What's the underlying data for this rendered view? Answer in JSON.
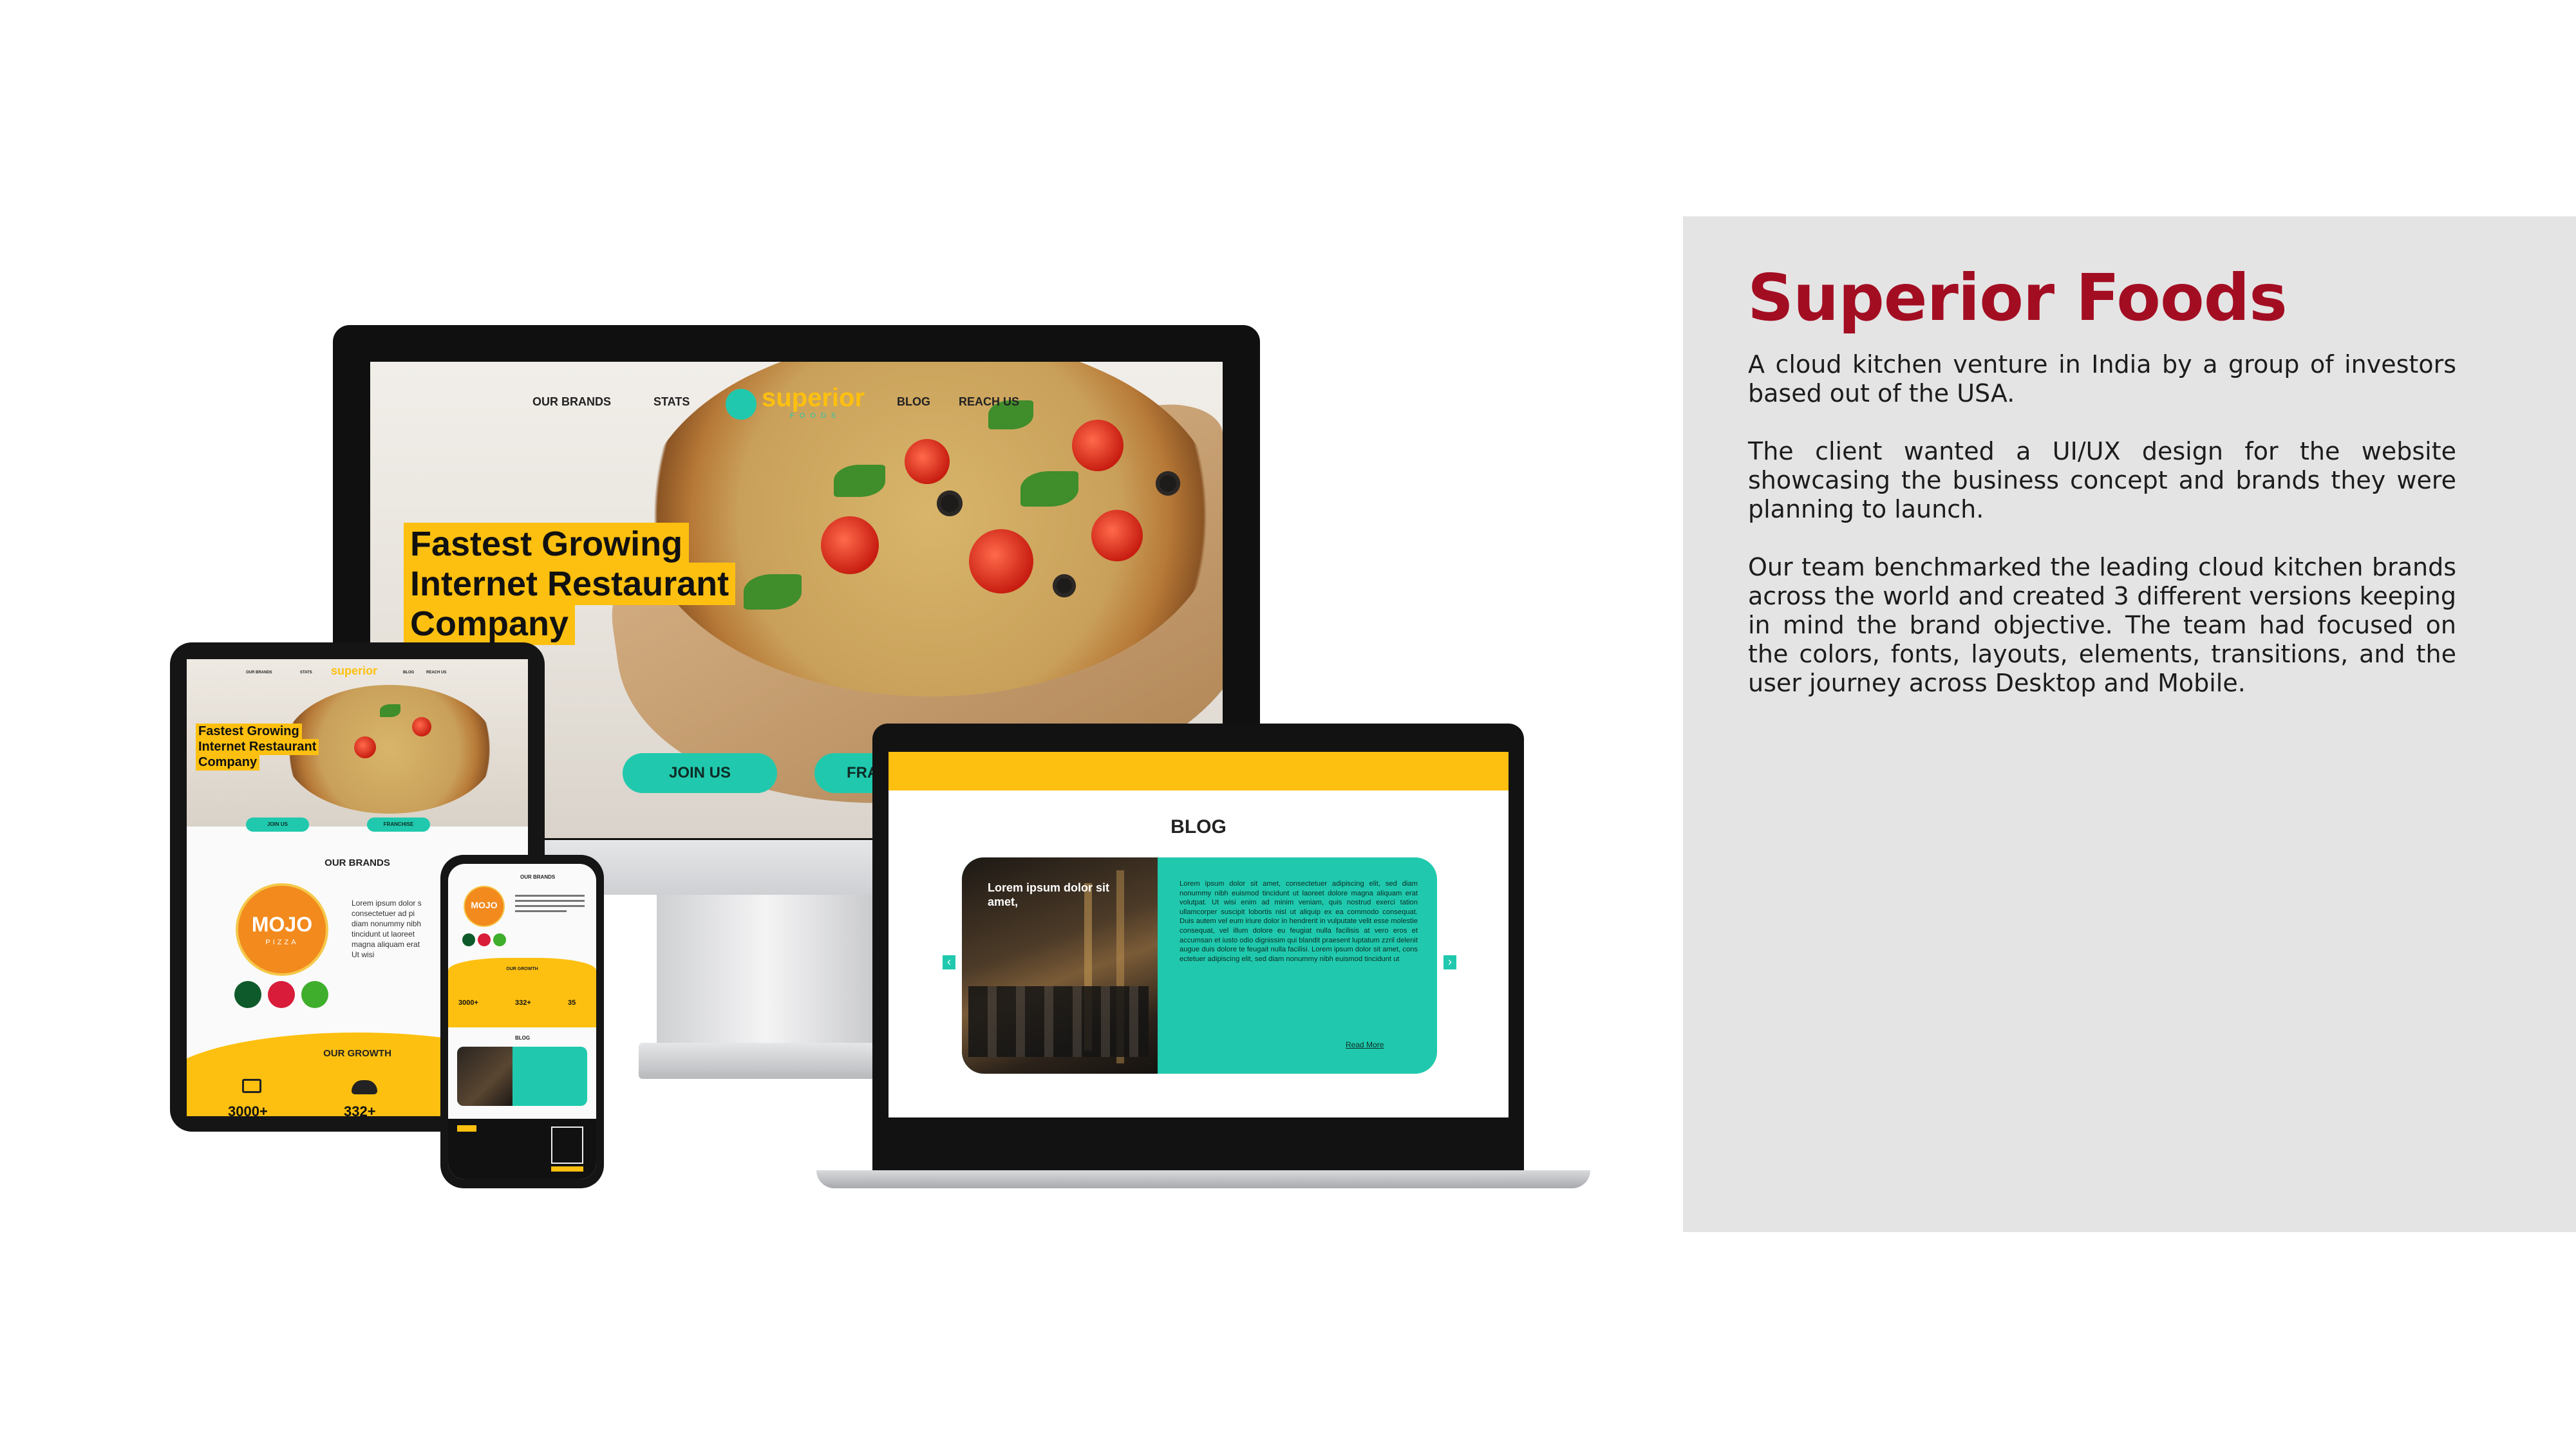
{
  "project": {
    "title": "Superior Foods",
    "paragraphs": [
      "A cloud kitchen venture in India by a group of investors based out of the USA.",
      "The client wanted a UI/UX design for the website showcasing the business concept and brands they were planning to launch.",
      "Our team benchmarked the leading cloud kitchen brands across the world and created 3 different versions keeping in mind the brand objective. The team had focused on the colors, fonts, layouts, elements, transitions, and the user journey across Desktop and Mobile."
    ]
  },
  "desktop": {
    "nav": [
      "OUR BRANDS",
      "STATS",
      "BLOG",
      "REACH US"
    ],
    "logo_text": "superior",
    "logo_sub": "FOODS",
    "hero": [
      "Fastest Growing",
      "Internet Restaurant",
      "Company"
    ],
    "join_button": "JOIN US",
    "franchise_button": "FRANCHISE"
  },
  "tablet": {
    "nav": [
      "OUR BRANDS",
      "STATS",
      "BLOG",
      "REACH US"
    ],
    "logo_text": "superior",
    "hero": [
      "Fastest Growing",
      "Internet Restaurant",
      "Company"
    ],
    "join_button": "JOIN US",
    "franchise_button": "FRANCHISE",
    "brands_heading": "OUR BRANDS",
    "brand_logo": "MOJO",
    "brand_logo_sub": "PIZZA",
    "brand_text": [
      "Lorem ipsum dolor s",
      "consectetuer ad pi",
      "diam nonummy nibh",
      "tincidunt ut laoreet",
      "magna aliquam erat",
      "Ut wisi"
    ],
    "growth_heading": "OUR GROWTH",
    "stats": [
      "3000+",
      "332+"
    ]
  },
  "phone": {
    "brands_heading": "OUR BRANDS",
    "brand_logo": "MOJO",
    "growth_heading": "OUR GROWTH",
    "stats": [
      "3000+",
      "332+",
      "35"
    ],
    "blog_heading": "BLOG"
  },
  "laptop": {
    "blog_heading": "BLOG",
    "card_title": "Lorem ipsum dolor sit amet,",
    "card_body": "Lorem ipsum dolor sit amet, consectetuer adipiscing elit, sed diam nonummy nibh euismod tincidunt ut laoreet dolore magna aliquam erat volutpat. Ut wisi enim ad minim veniam, quis nostrud exerci tation ullamcorper suscipit lobortis nisl ut aliquip ex ea commodo consequat. Duis autem vel eum iriure dolor in hendrerit in vulputate velit esse molestie consequat, vel illum dolore eu feugiat nulla facilisis at vero eros et accumsan et iusto odio dignissim qui blandit praesent luptatum zzril delenit augue duis dolore te feugait nulla facilisi. Lorem ipsum dolor sit amet, cons ectetuer adipiscing elit, sed diam nonummy nibh euismod tincidunt ut",
    "read_more": "Read More",
    "prev_arrow": "‹",
    "next_arrow": "›"
  },
  "colors": {
    "title_red": "#a30d22",
    "brand_yellow": "#fdc010",
    "brand_teal": "#20c9ad",
    "panel_gray": "#e4e4e4"
  }
}
